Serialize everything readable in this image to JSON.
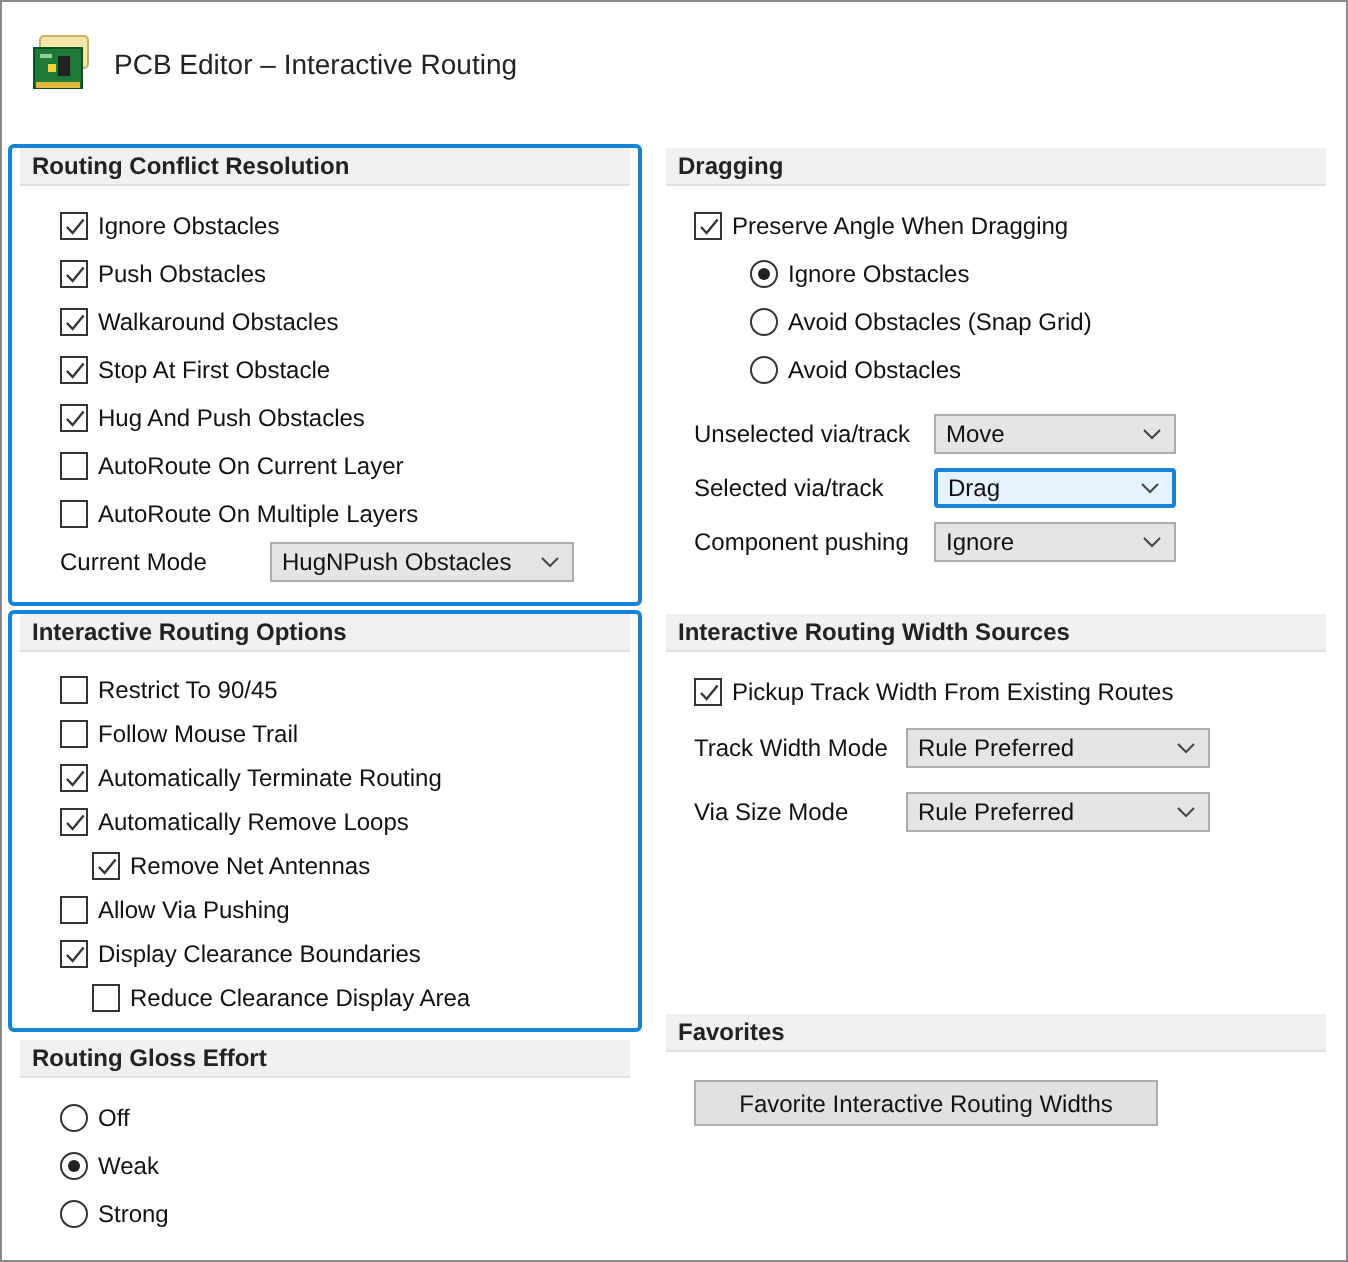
{
  "window": {
    "title": "PCB Editor – Interactive Routing"
  },
  "columns": [
    {
      "sections": [
        {
          "title": "Routing Conflict Resolution",
          "highlighted": true,
          "items": [
            {
              "kind": "checkbox",
              "label": "Ignore Obstacles",
              "checked": true
            },
            {
              "kind": "checkbox",
              "label": "Push Obstacles",
              "checked": true
            },
            {
              "kind": "checkbox",
              "label": "Walkaround Obstacles",
              "checked": true
            },
            {
              "kind": "checkbox",
              "label": "Stop At First Obstacle",
              "checked": true
            },
            {
              "kind": "checkbox",
              "label": "Hug And Push Obstacles",
              "checked": true
            },
            {
              "kind": "checkbox",
              "label": "AutoRoute On Current Layer",
              "checked": false
            },
            {
              "kind": "checkbox",
              "label": "AutoRoute On Multiple Layers",
              "checked": false
            },
            {
              "kind": "select",
              "label": "Current Mode",
              "value": "HugNPush Obstacles",
              "focused": false
            }
          ]
        },
        {
          "title": "Interactive Routing Options",
          "highlighted": true,
          "items": [
            {
              "kind": "checkbox",
              "label": "Restrict To 90/45",
              "checked": false
            },
            {
              "kind": "checkbox",
              "label": "Follow Mouse Trail",
              "checked": false
            },
            {
              "kind": "checkbox",
              "label": "Automatically Terminate Routing",
              "checked": true
            },
            {
              "kind": "checkbox",
              "label": "Automatically Remove Loops",
              "checked": true,
              "children": [
                {
                  "kind": "checkbox",
                  "label": "Remove Net Antennas",
                  "checked": true
                }
              ]
            },
            {
              "kind": "checkbox",
              "label": "Allow Via Pushing",
              "checked": false
            },
            {
              "kind": "checkbox",
              "label": "Display Clearance Boundaries",
              "checked": true,
              "children": [
                {
                  "kind": "checkbox",
                  "label": "Reduce Clearance Display Area",
                  "checked": false
                }
              ]
            }
          ]
        },
        {
          "title": "Routing Gloss Effort",
          "highlighted": false,
          "items": [
            {
              "kind": "radio",
              "label": "Off",
              "selected": false
            },
            {
              "kind": "radio",
              "label": "Weak",
              "selected": true
            },
            {
              "kind": "radio",
              "label": "Strong",
              "selected": false
            }
          ]
        }
      ]
    },
    {
      "sections": [
        {
          "title": "Dragging",
          "highlighted": false,
          "items": [
            {
              "kind": "checkbox",
              "label": "Preserve Angle When Dragging",
              "checked": true,
              "children": [
                {
                  "kind": "radio",
                  "label": "Ignore Obstacles",
                  "selected": true
                },
                {
                  "kind": "radio",
                  "label": "Avoid Obstacles (Snap Grid)",
                  "selected": false
                },
                {
                  "kind": "radio",
                  "label": "Avoid Obstacles",
                  "selected": false
                }
              ]
            },
            {
              "kind": "select",
              "label": "Unselected via/track",
              "value": "Move",
              "focused": false
            },
            {
              "kind": "select",
              "label": "Selected via/track",
              "value": "Drag",
              "focused": true
            },
            {
              "kind": "select",
              "label": "Component pushing",
              "value": "Ignore",
              "focused": false
            }
          ]
        },
        {
          "title": "Interactive Routing Width Sources",
          "highlighted": false,
          "items": [
            {
              "kind": "checkbox",
              "label": "Pickup Track Width From Existing Routes",
              "checked": true
            },
            {
              "kind": "select",
              "label": "Track Width Mode",
              "value": "Rule Preferred",
              "focused": false
            },
            {
              "kind": "select",
              "label": "Via Size Mode",
              "value": "Rule Preferred",
              "focused": false
            }
          ]
        },
        {
          "title": "Favorites",
          "highlighted": false,
          "items": [
            {
              "kind": "button",
              "label": "Favorite Interactive Routing Widths"
            }
          ]
        }
      ]
    }
  ]
}
